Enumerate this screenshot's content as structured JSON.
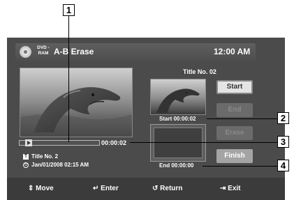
{
  "header": {
    "disc_label": "DVD -RAM",
    "title": "A-B Erase",
    "clock": "12:00 AM"
  },
  "preview": {
    "time": "00:00:02",
    "title_info": "Title No. 2",
    "date_info": "Jan/01/2008  02:15 AM"
  },
  "side": {
    "title_number": "Title No. 02",
    "start_label": "Start 00:00:02",
    "end_label": "End 00:00:00"
  },
  "buttons": {
    "start": "Start",
    "end": "End",
    "erase": "Erase",
    "finish": "Finish"
  },
  "footer": {
    "move": "Move",
    "enter": "Enter",
    "return": "Return",
    "exit": "Exit"
  },
  "callouts": [
    "1",
    "2",
    "3",
    "4"
  ],
  "colors": {
    "screen_bg": "#4b4b4b",
    "footer_bg": "#3b3b3b",
    "active_button": "#e4e4e4",
    "finish_button": "#a4a4a4"
  }
}
